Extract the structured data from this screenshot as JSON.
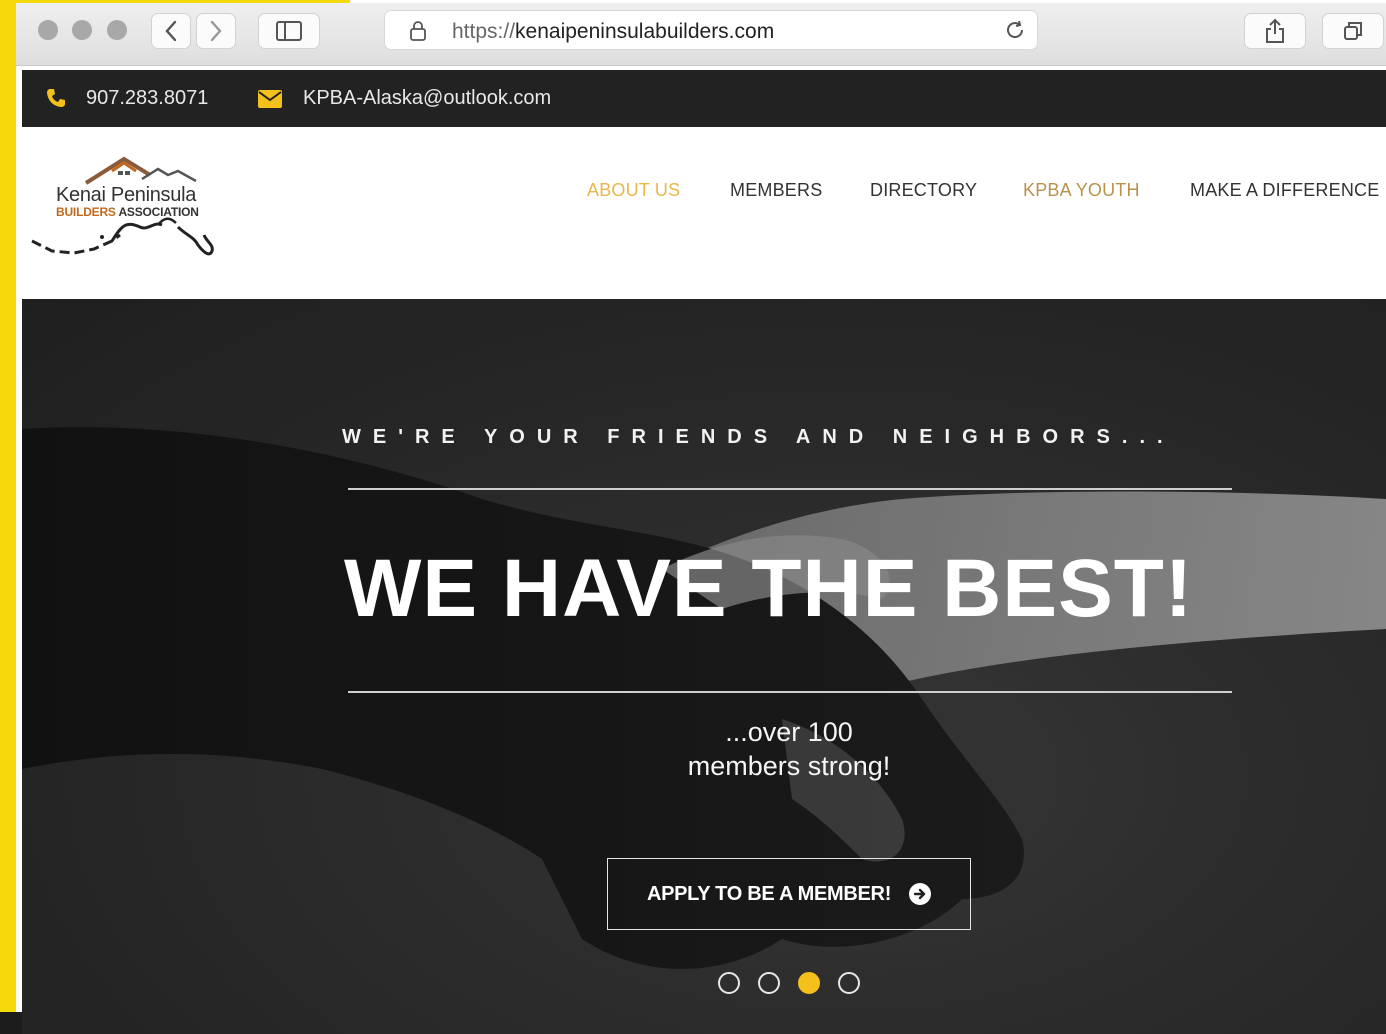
{
  "browser": {
    "url_protocol": "https://",
    "url_domain": "kenaipeninsulabuilders.com",
    "back_icon": "chevron-left-icon",
    "forward_icon": "chevron-right-icon",
    "sidebar_icon": "sidebar-icon",
    "reload_icon": "reload-icon",
    "share_icon": "share-icon",
    "tabs_icon": "tabs-icon"
  },
  "contact": {
    "phone": "907.283.8071",
    "email": "KPBA-Alaska@outlook.com",
    "icon_color": "#f4c01c"
  },
  "logo": {
    "line1": "Kenai Peninsula",
    "line2_a": "BUILDERS",
    "line2_b": "ASSOCIATION"
  },
  "nav": {
    "items": [
      {
        "label": "ABOUT US",
        "color": "#e6b84a"
      },
      {
        "label": "MEMBERS",
        "color": "#333333"
      },
      {
        "label": "DIRECTORY",
        "color": "#333333"
      },
      {
        "label": "KPBA YOUTH",
        "color": "#b9924a"
      },
      {
        "label": "MAKE A DIFFERENCE",
        "color": "#333333"
      }
    ]
  },
  "hero": {
    "tagline": "WE'RE YOUR FRIENDS AND NEIGHBORS...",
    "headline": "WE HAVE THE BEST!",
    "sub_line1": "...over 100",
    "sub_line2": "members strong!",
    "cta_label": "APPLY TO BE A MEMBER!",
    "slider": {
      "count": 4,
      "active_index": 2,
      "active_color": "#f4c01c"
    }
  }
}
